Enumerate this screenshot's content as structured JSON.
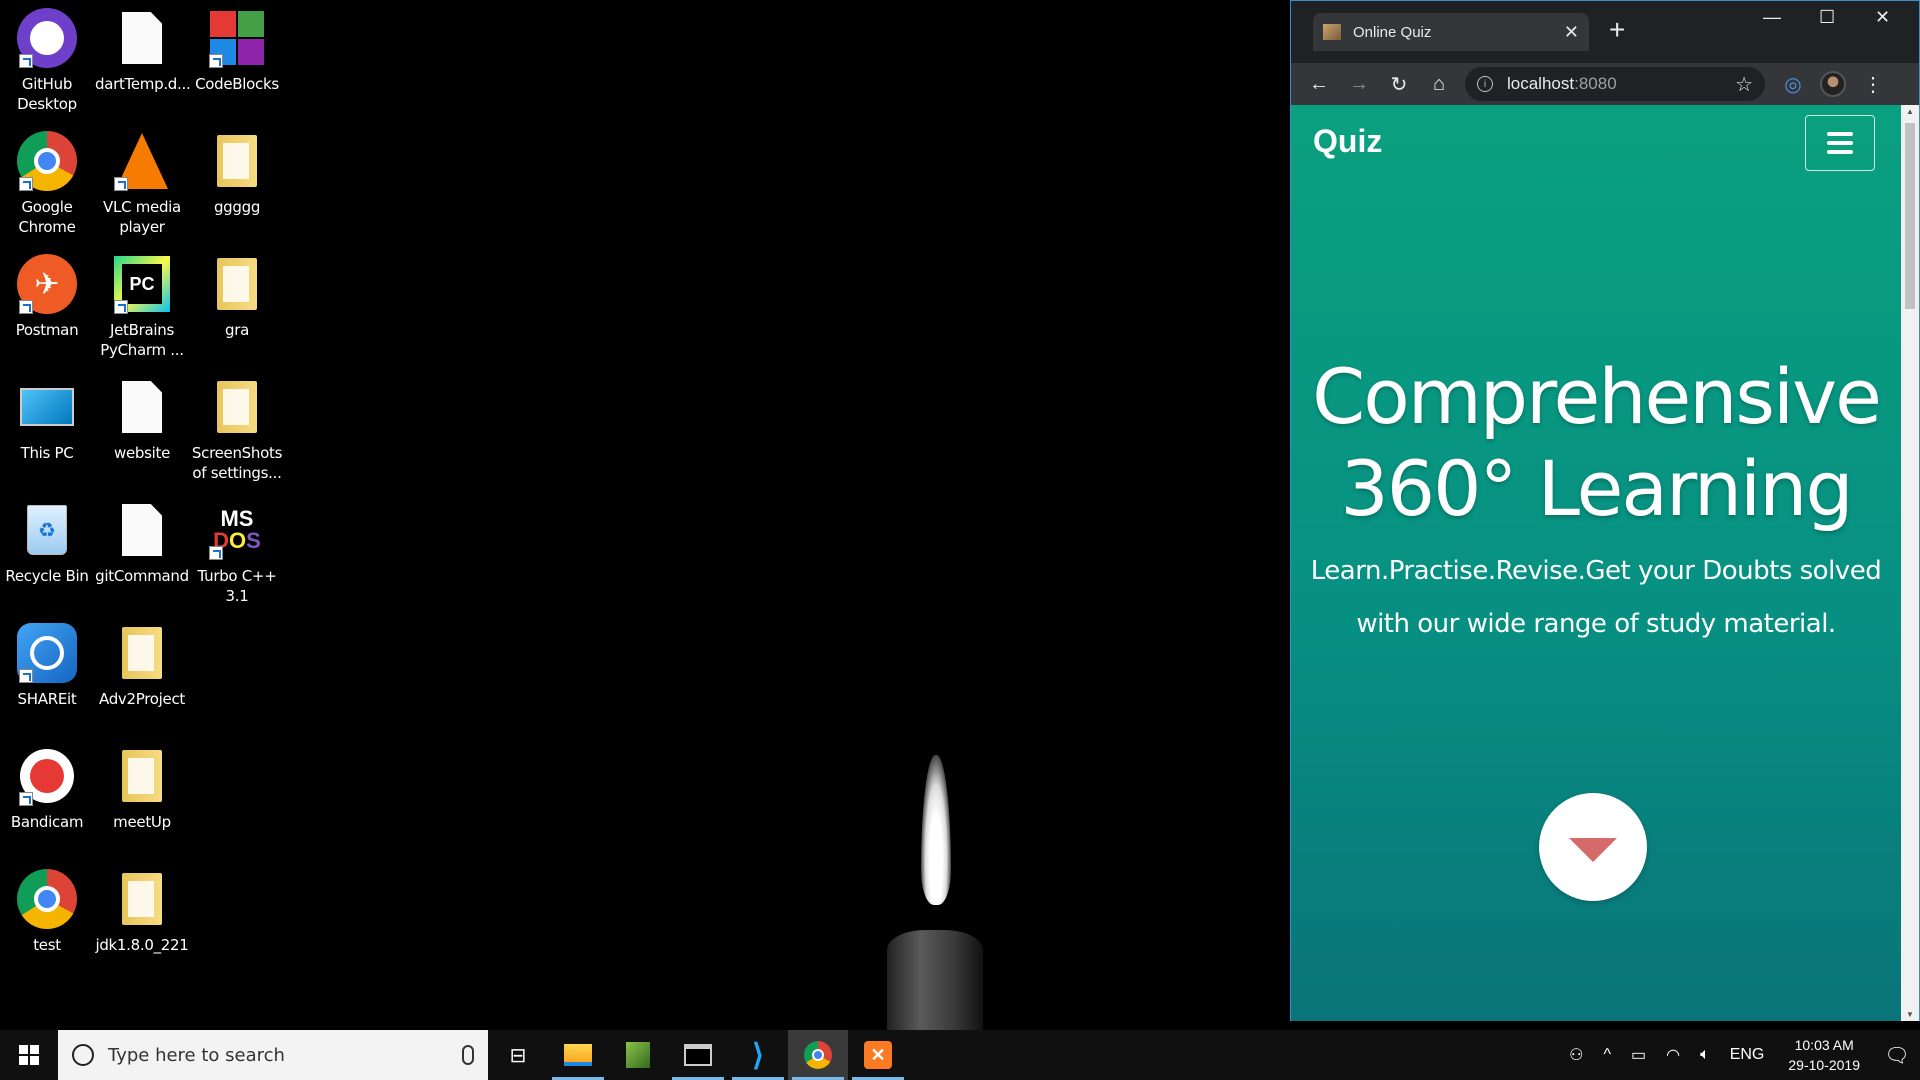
{
  "desktop": {
    "icons": [
      {
        "label": "GitHub\nDesktop"
      },
      {
        "label": "dartTemp.d..."
      },
      {
        "label": "CodeBlocks"
      },
      {
        "label": "Google\nChrome"
      },
      {
        "label": "VLC media\nplayer"
      },
      {
        "label": "ggggg"
      },
      {
        "label": "Postman"
      },
      {
        "label": "JetBrains\nPyCharm ..."
      },
      {
        "label": "gra"
      },
      {
        "label": "This PC"
      },
      {
        "label": "website"
      },
      {
        "label": "ScreenShots\nof settings..."
      },
      {
        "label": "Recycle Bin"
      },
      {
        "label": "gitCommand"
      },
      {
        "label": "Turbo C++\n3.1"
      },
      {
        "label": "SHAREit"
      },
      {
        "label": "Adv2Project"
      },
      {
        "label": "Bandicam"
      },
      {
        "label": "meetUp"
      },
      {
        "label": "test"
      },
      {
        "label": "jdk1.8.0_221"
      }
    ]
  },
  "browser": {
    "tab_title": "Online Quiz",
    "url_host": "localhost",
    "url_port": ":8080",
    "window_controls": {
      "minimize": "—",
      "maximize": "☐",
      "close": "✕"
    }
  },
  "page": {
    "brand": "Quiz",
    "hero_title_line1": "Comprehensive",
    "hero_title_line2": "360° Learning",
    "hero_subtitle_line1": "Learn.Practise.Revise.Get your Doubts solved",
    "hero_subtitle_line2": "with our wide range of study material.",
    "accent_color": "#0aa07f",
    "arrow_color": "#d46a6a"
  },
  "taskbar": {
    "search_placeholder": "Type here to search",
    "language": "ENG",
    "time": "10:03 AM",
    "date": "29-10-2019"
  }
}
